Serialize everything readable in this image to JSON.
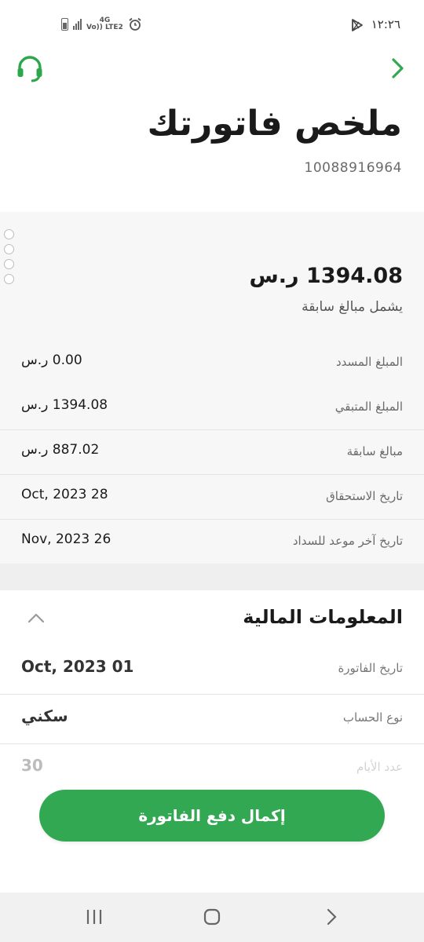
{
  "status_bar": {
    "time": "١٢:٢٦",
    "network_top": "4G",
    "network_bottom": "Vo)) LTE2"
  },
  "header": {
    "back_icon": "chevron-right-icon",
    "support_icon": "headset-icon",
    "title": "ملخص فاتورتك",
    "bill_number": "10088916964"
  },
  "summary": {
    "total_amount": "1394.08 ر.س",
    "total_note": "يشمل مبالغ سابقة",
    "rows": [
      {
        "label": "المبلغ المسدد",
        "value": "0.00 ر.س"
      },
      {
        "label": "المبلغ المتبقي",
        "value": "1394.08 ر.س"
      },
      {
        "label": "مبالغ سابقة",
        "value": "887.02 ر.س"
      },
      {
        "label": "تاريخ الاستحقاق",
        "value": "28 Oct, 2023"
      },
      {
        "label": "تاريخ آخر موعد للسداد",
        "value": "26 Nov, 2023"
      }
    ]
  },
  "financial_info": {
    "title": "المعلومات المالية",
    "rows": [
      {
        "label": "تاريخ الفاتورة",
        "value": "01 Oct, 2023"
      },
      {
        "label": "نوع الحساب",
        "value": "سكني"
      },
      {
        "label": "عدد الأيام",
        "value": "30"
      }
    ]
  },
  "pay_button_label": "إكمال دفع الفاتورة",
  "colors": {
    "accent_green": "#33a853",
    "support_icon_green": "#2aa84a"
  }
}
